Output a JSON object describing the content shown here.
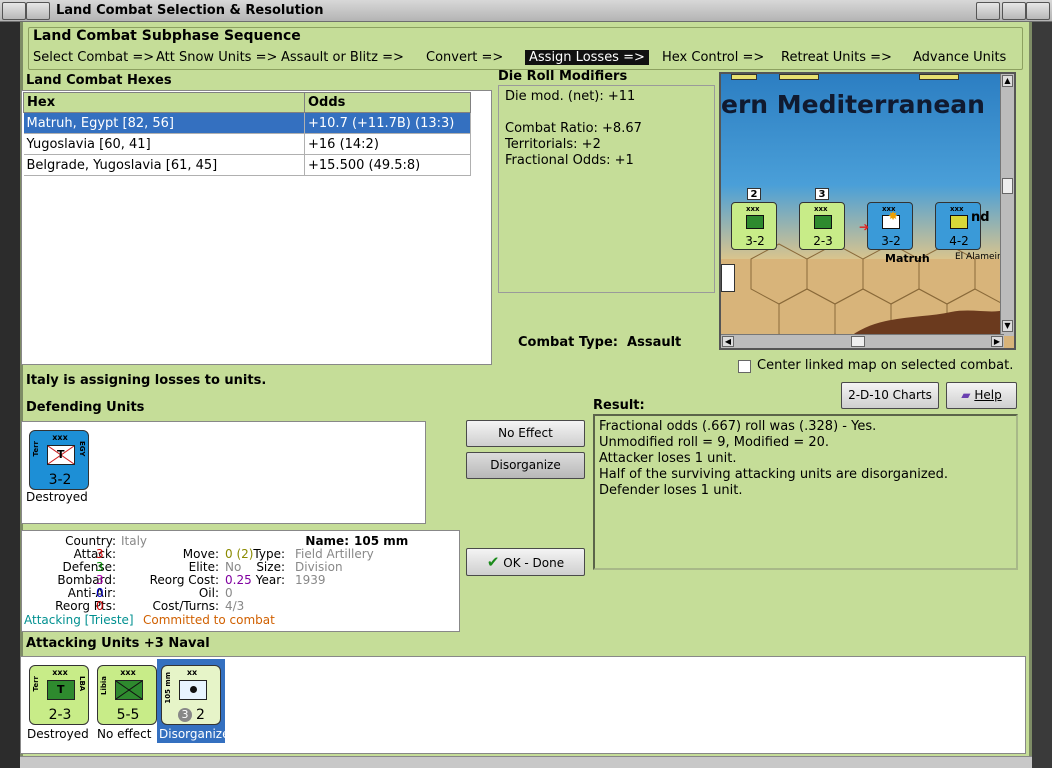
{
  "window": {
    "title": "Land Combat Selection & Resolution"
  },
  "sequence": {
    "title": "Land Combat Subphase Sequence",
    "steps": [
      "Select Combat =>",
      "Att Snow Units =>",
      "Assault or Blitz =>",
      "Convert =>",
      "Assign Losses =>",
      "Hex Control =>",
      "Retreat Units =>",
      "Advance Units"
    ],
    "active_index": 4
  },
  "hexes": {
    "title": "Land Combat Hexes",
    "columns": [
      "Hex",
      "Odds"
    ],
    "rows": [
      {
        "hex": "Matruh, Egypt [82, 56]",
        "odds": "+10.7 (+11.7B) (13:3)"
      },
      {
        "hex": "Yugoslavia [60, 41]",
        "odds": "+16 (14:2)"
      },
      {
        "hex": "Belgrade, Yugoslavia [61, 45]",
        "odds": "+15.500 (49.5:8)"
      }
    ],
    "selected_index": 0
  },
  "modifiers": {
    "title": "Die Roll Modifiers",
    "lines": [
      "Die mod. (net): +11",
      "",
      "Combat Ratio: +8.67",
      "Territorials: +2",
      "Fractional Odds: +1"
    ]
  },
  "combat_type": {
    "label": "Combat Type:",
    "value": "Assault"
  },
  "map": {
    "title": "ern Mediterranean",
    "places": [
      "Matruh",
      "El Alamein"
    ],
    "partial_text": "nd",
    "counters": [
      {
        "value": "3-2",
        "top": "xxx",
        "stack": "2",
        "color": "#c8ec88"
      },
      {
        "value": "2-3",
        "top": "xxx",
        "stack": "3",
        "color": "#c8ec88"
      },
      {
        "value": "3-2",
        "top": "xxx",
        "color": "#3a9ad8"
      },
      {
        "value": "4-2",
        "top": "xxx",
        "color": "#3a9ad8"
      }
    ]
  },
  "center_map": {
    "label": "Center linked map on selected combat.",
    "checked": false
  },
  "assigning_text": "Italy is assigning losses to units.",
  "buttons": {
    "charts": "2-D-10 Charts",
    "help": "Help",
    "no_effect": "No Effect",
    "disorganize": "Disorganize",
    "ok": "OK - Done"
  },
  "defending": {
    "title": "Defending Units",
    "units": [
      {
        "value": "3-2",
        "top": "xxx",
        "left": "Terr",
        "right": "EGY",
        "symbol": "T",
        "caption": "Destroyed"
      }
    ]
  },
  "unit_info": {
    "country_label": "Country:",
    "country": "Italy",
    "attack_label": "Attack:",
    "attack": "3",
    "defense_label": "Defense:",
    "defense": "3",
    "bombard_label": "Bombard:",
    "bombard": "3",
    "antiair_label": "Anti-Air:",
    "antiair": "0",
    "reorgpts_label": "Reorg Pts:",
    "reorgpts": "0",
    "name_label": "Name:",
    "name": "105 mm",
    "move_label": "Move:",
    "move": "0",
    "move_extra": "(2)",
    "type_label": "Type:",
    "type": "Field Artillery",
    "elite_label": "Elite:",
    "elite": "No",
    "size_label": "Size:",
    "size": "Division",
    "reorgcost_label": "Reorg Cost:",
    "reorgcost": "0.25",
    "year_label": "Year:",
    "year": "1939",
    "oil_label": "Oil:",
    "oil": "0",
    "costturns_label": "Cost/Turns:",
    "costturns": "4/3",
    "attacking": "Attacking [Trieste]",
    "committed": "Committed to combat"
  },
  "result": {
    "title": "Result:",
    "lines": [
      "Fractional odds (.667) roll was (.328)  - Yes.",
      "Unmodified roll = 9, Modified = 20.",
      "Attacker loses 1 unit.",
      "Half of the surviving attacking units are disorganized.",
      "Defender loses 1 unit."
    ]
  },
  "attacking": {
    "title": "Attacking Units +3 Naval",
    "units": [
      {
        "value": "2-3",
        "top": "xxx",
        "left": "Terr",
        "right": "LBA",
        "symbol": "T",
        "caption": "Destroyed"
      },
      {
        "value": "5-5",
        "top": "xxx",
        "left": "Libia",
        "right": "",
        "symbol": "X",
        "caption": "No effect"
      },
      {
        "value": "2",
        "badge": "3",
        "top": "xx",
        "left": "105 mm",
        "right": "",
        "symbol": "dot",
        "caption": "Disorganized"
      }
    ],
    "selected_index": 2
  },
  "colors": {
    "panel": "#c5dd98",
    "selection": "#3470c0",
    "attack_red": "#cc0000",
    "defense_green": "#008800",
    "bombard_magenta": "#b000b0",
    "antiair_blue": "#0000cc",
    "reorg_red": "#cc0000",
    "move_olive": "#8a8a00",
    "reorgcost_purple": "#8000a0",
    "gray_value": "#888888",
    "attacking_teal": "#009090",
    "committed_orange": "#d06000"
  }
}
